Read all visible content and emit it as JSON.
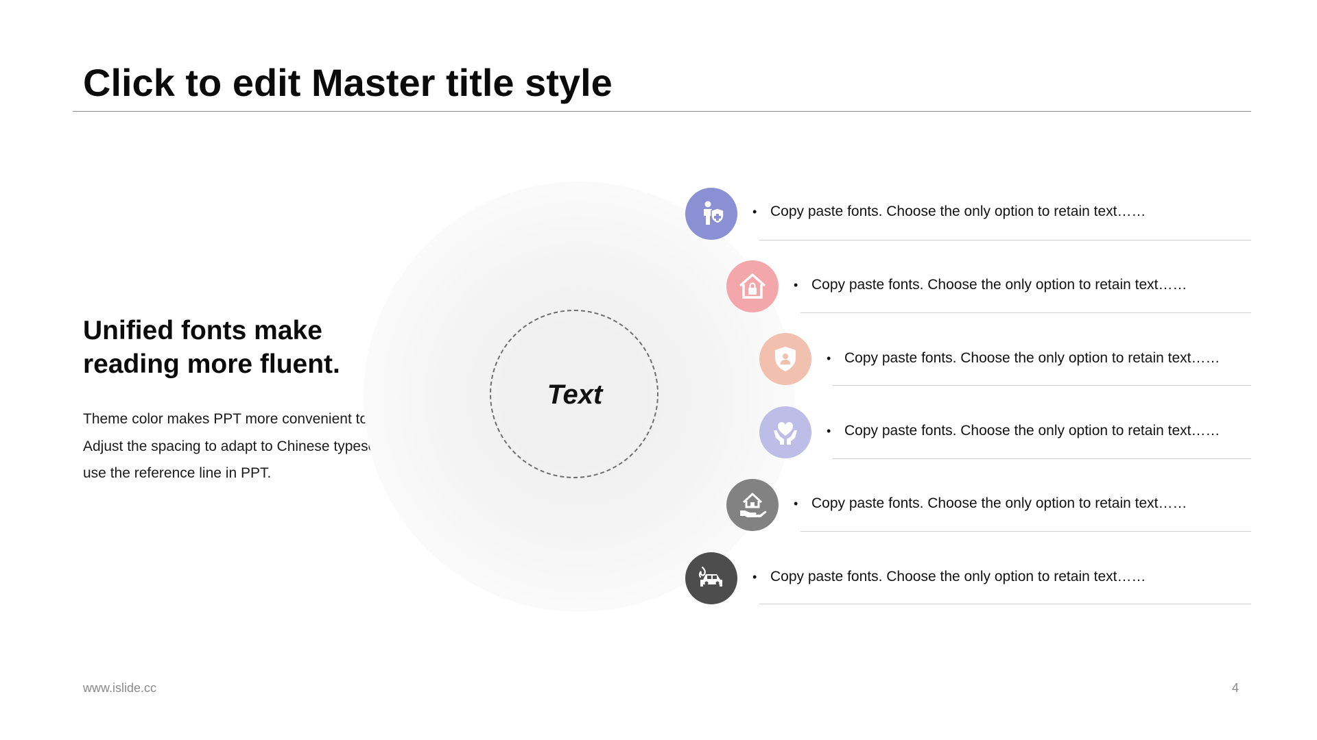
{
  "title": "Click to edit Master title style",
  "heading": {
    "line1": "Unified fonts make",
    "line2": "reading more fluent."
  },
  "body": {
    "line1": "Theme color makes PPT more convenient to change.",
    "line2": "Adjust the spacing to adapt to Chinese typesetting,",
    "line3": "use the reference line in PPT."
  },
  "center_label": "Text",
  "items": [
    {
      "text": "Copy paste fonts. Choose the only option to retain text……",
      "icon": "person-shield-icon",
      "color": "#8b8fd3"
    },
    {
      "text": "Copy paste fonts. Choose the only option to retain text……",
      "icon": "house-lock-icon",
      "color": "#f4a7ab"
    },
    {
      "text": "Copy paste fonts. Choose the only option to retain text……",
      "icon": "shield-person-icon",
      "color": "#f2c0ae"
    },
    {
      "text": "Copy paste fonts. Choose the only option to retain text……",
      "icon": "heart-hands-icon",
      "color": "#bdbde8"
    },
    {
      "text": "Copy paste fonts. Choose the only option to retain text……",
      "icon": "house-hand-icon",
      "color": "#828282"
    },
    {
      "text": "Copy paste fonts. Choose the only option to retain text……",
      "icon": "car-fire-icon",
      "color": "#4d4d4d"
    }
  ],
  "bullet": "•",
  "footer": {
    "url": "www.islide.cc",
    "page": "4"
  }
}
